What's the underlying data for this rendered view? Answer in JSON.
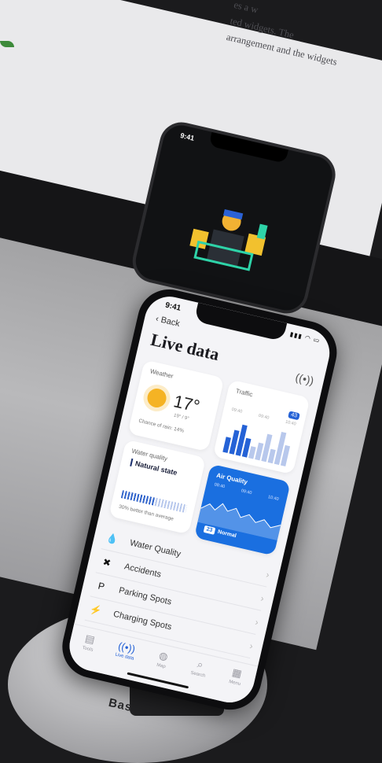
{
  "monitor": {
    "text_line1": "es a w",
    "text_line2": "ted widgets. The",
    "text_line3": "arrangement and the widgets"
  },
  "small_phone": {
    "time": "9:41"
  },
  "status": {
    "time": "9:41"
  },
  "nav": {
    "back_label": "Back"
  },
  "page": {
    "title": "Live data"
  },
  "weather": {
    "label": "Weather",
    "temperature": "17°",
    "range": "19° / 9°",
    "rain": "Chance of rain: 14%",
    "icon": "sun-icon"
  },
  "traffic": {
    "label": "Traffic",
    "badge": "43",
    "ticks": [
      "09:40",
      "09:40",
      "10:40"
    ],
    "bar_heights": [
      0.45,
      0.7,
      0.9,
      0.55,
      0.35,
      0.5,
      0.8,
      0.4,
      0.95,
      0.6
    ],
    "bar_active": [
      true,
      true,
      true,
      true,
      false,
      false,
      false,
      false,
      false,
      false
    ]
  },
  "water_quality": {
    "label": "Water quality",
    "state": "Natural state",
    "note": "30% better than average",
    "level": 0.55
  },
  "air_quality": {
    "label": "Air Quality",
    "ticks": [
      "08:40",
      "09:40",
      "10:40"
    ],
    "value": "23",
    "status": "Normal"
  },
  "list": [
    {
      "label": "Water Quality",
      "icon": "drops-icon"
    },
    {
      "label": "Accidents",
      "icon": "x-icon"
    },
    {
      "label": "Parking Spots",
      "icon": "parking-icon"
    },
    {
      "label": "Charging Spots",
      "icon": "charging-icon"
    }
  ],
  "tabs": [
    {
      "label": "Tools",
      "icon": "tools-icon",
      "active": false
    },
    {
      "label": "Live data",
      "icon": "broadcast-icon",
      "active": true
    },
    {
      "label": "Map",
      "icon": "globe-icon",
      "active": false
    },
    {
      "label": "Search",
      "icon": "search-icon",
      "active": false
    },
    {
      "label": "Menu",
      "icon": "grid-icon",
      "active": false
    }
  ],
  "stand": {
    "brand": "Bas"
  },
  "colors": {
    "accent": "#2562d6",
    "air_quality_bg": "#1a6fe0",
    "sun": "#f5b324"
  }
}
